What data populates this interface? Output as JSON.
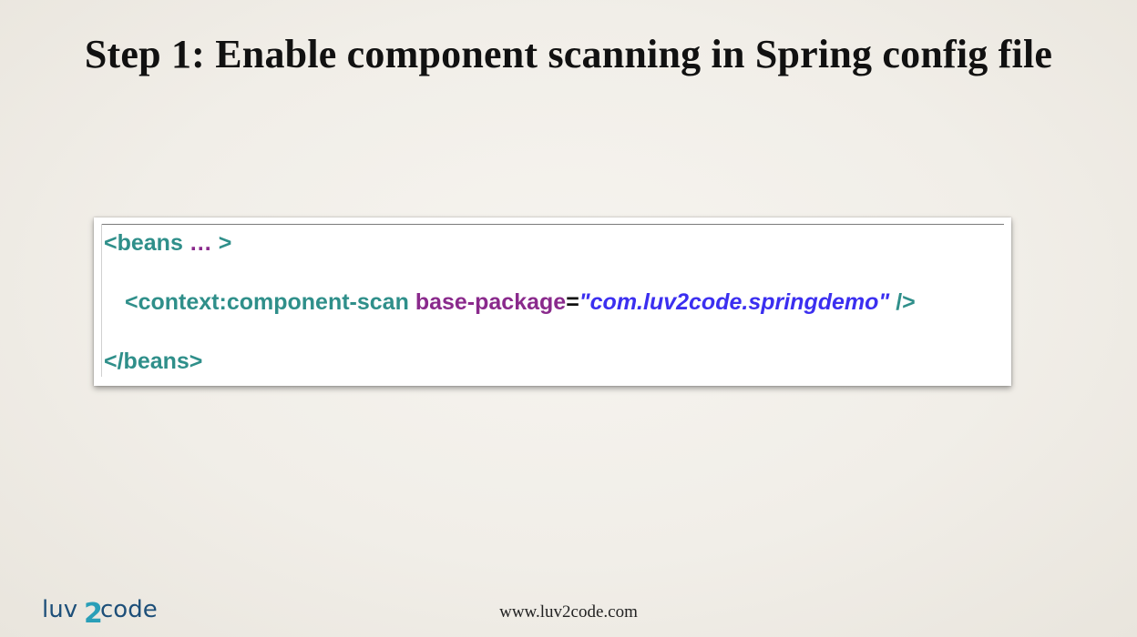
{
  "slide": {
    "title": "Step 1: Enable component scanning in Spring config file",
    "footer_url": "www.luv2code.com",
    "logo_text": "luv2code"
  },
  "code": {
    "line1": {
      "open": "<beans",
      "ellipsis": " … ",
      "close": ">"
    },
    "line2": {
      "tag": "<context:component-scan",
      "attr": "base-package",
      "eq": "=",
      "value": "\"com.luv2code.springdemo\"",
      "end": " />"
    },
    "line3": {
      "close_tag": "</beans>"
    }
  },
  "colors": {
    "tag": "#2f8f8a",
    "attribute": "#8a2a8c",
    "string": "#3b2ff0"
  }
}
